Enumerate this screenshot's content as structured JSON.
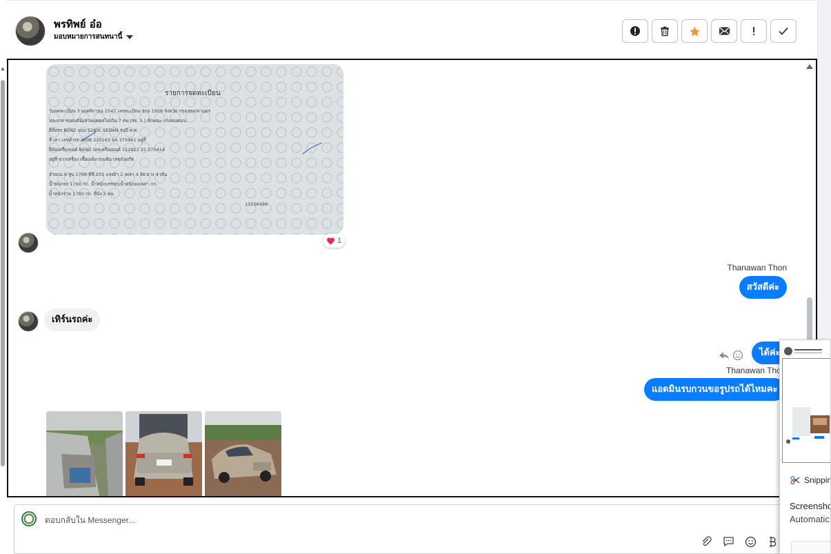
{
  "header": {
    "contact_name": "พรทิพย์ อ๋อ",
    "assign_label": "มอบหมายการสนทนานี้",
    "actions": [
      {
        "icon": "info-icon"
      },
      {
        "icon": "trash-icon"
      },
      {
        "icon": "star-icon"
      },
      {
        "icon": "envelope-icon"
      },
      {
        "icon": "exclamation-icon"
      },
      {
        "icon": "check-icon"
      }
    ]
  },
  "colors": {
    "accent": "#0a7cff",
    "star": "#f7923a",
    "incoming_bubble": "#f0f0f0"
  },
  "document_photo": {
    "heading": "รายการจดทะเบียน",
    "lines": [
      "วันจดทะเบียน  3 พฤศจิกายน 2547  เลขทะเบียน  9กอ 1958  จังหวัด  กรุงเทพมหานคร",
      "ประเภท  รถยนต์นั่งส่วนบุคคลไม่เกิน 7 คน  (รย.  1 ) ลักษณะ  เก๋งสองตอน",
      "ยี่ห้อรถ  BENZ        แบบ  S280L SEDAN        รุ่นปี ค.ศ.",
      "สี  เทา        เลขตัวรถ  WDB 220163 6A 375961        อยู่ที่  ",
      "ยี่ห้อเครื่องยนต์  BENZ        เลขเครื่องยนต์  112922 31 575414",
      "อยู่ที่  ขวาเครื่อง        เชื้อเพลิง  เบนซิน        เลขถังแก๊ส",
      "จำนวน  6 สูบ    2799  ซีซี    201 แรงม้า      2 เพลา 4 ล้อ ยาง 4 เส้น",
      "น้ำหนักรถ  1700  กก.  น้ำหนักบรรทุก/น้ำหนักลงเพลา        กก.",
      "น้ำหนักรวม  1700  กก.  ที่นั่ง  5  คน",
      "11236456"
    ],
    "reaction_count": "1"
  },
  "messages": [
    {
      "sender": "Thanawan Thon",
      "text": "สวัสดีค่ะ",
      "direction": "out"
    },
    {
      "text": "เทิร์นรถค่ะ",
      "direction": "in"
    },
    {
      "text": "ได้ค่ะ",
      "direction": "out"
    },
    {
      "sender": "Thanawan Thon",
      "text": "แอดมินรบกวนขอรูปรถได้ไหมคะ",
      "direction": "out"
    }
  ],
  "reply": {
    "placeholder": "ตอบกลับใน Messenger...",
    "tools": [
      "paperclip-icon",
      "comment-icon",
      "smiley-icon",
      "baht-icon"
    ]
  },
  "popup": {
    "app_name": "Snippin",
    "title": "Screensho",
    "subtitle": "Automatic"
  },
  "car_photos": [
    {
      "alt": "car-interior-photo"
    },
    {
      "alt": "car-rear-photo"
    },
    {
      "alt": "car-front-photo"
    }
  ]
}
